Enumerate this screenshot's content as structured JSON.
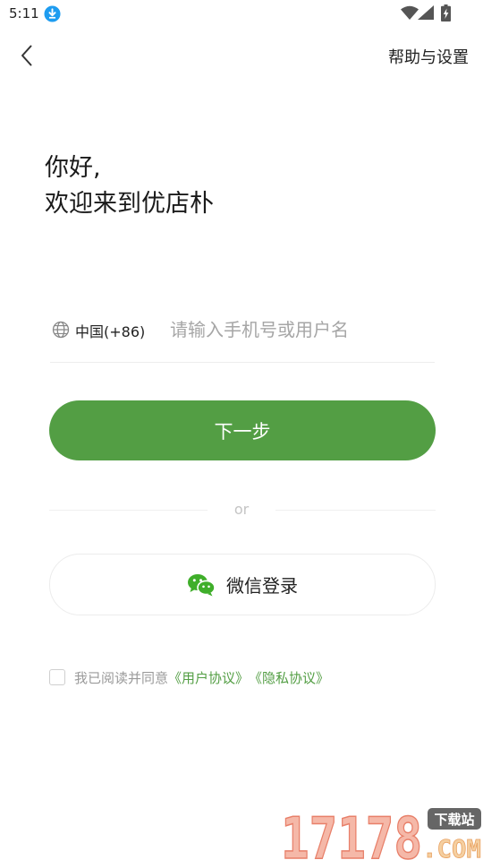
{
  "status_bar": {
    "time": "5:11"
  },
  "header": {
    "help_settings": "帮助与设置"
  },
  "greeting": {
    "line1": "你好,",
    "line2": "欢迎来到优店朴"
  },
  "phone": {
    "country_code": "中国(+86)",
    "placeholder": "请输入手机号或用户名",
    "value": ""
  },
  "next_button": {
    "label": "下一步"
  },
  "divider": {
    "text": "or"
  },
  "wechat_button": {
    "label": "微信登录"
  },
  "agreement": {
    "prefix": "我已阅读并同意",
    "user_agreement": "《用户协议》",
    "privacy_agreement": "《隐私协议》"
  },
  "watermark": {
    "number": "17178",
    "tag": "下载站",
    "suffix": ".COM"
  },
  "colors": {
    "accent": "#539e44",
    "download_badge": "#1e9cf0",
    "placeholder": "#a6a6a6"
  }
}
